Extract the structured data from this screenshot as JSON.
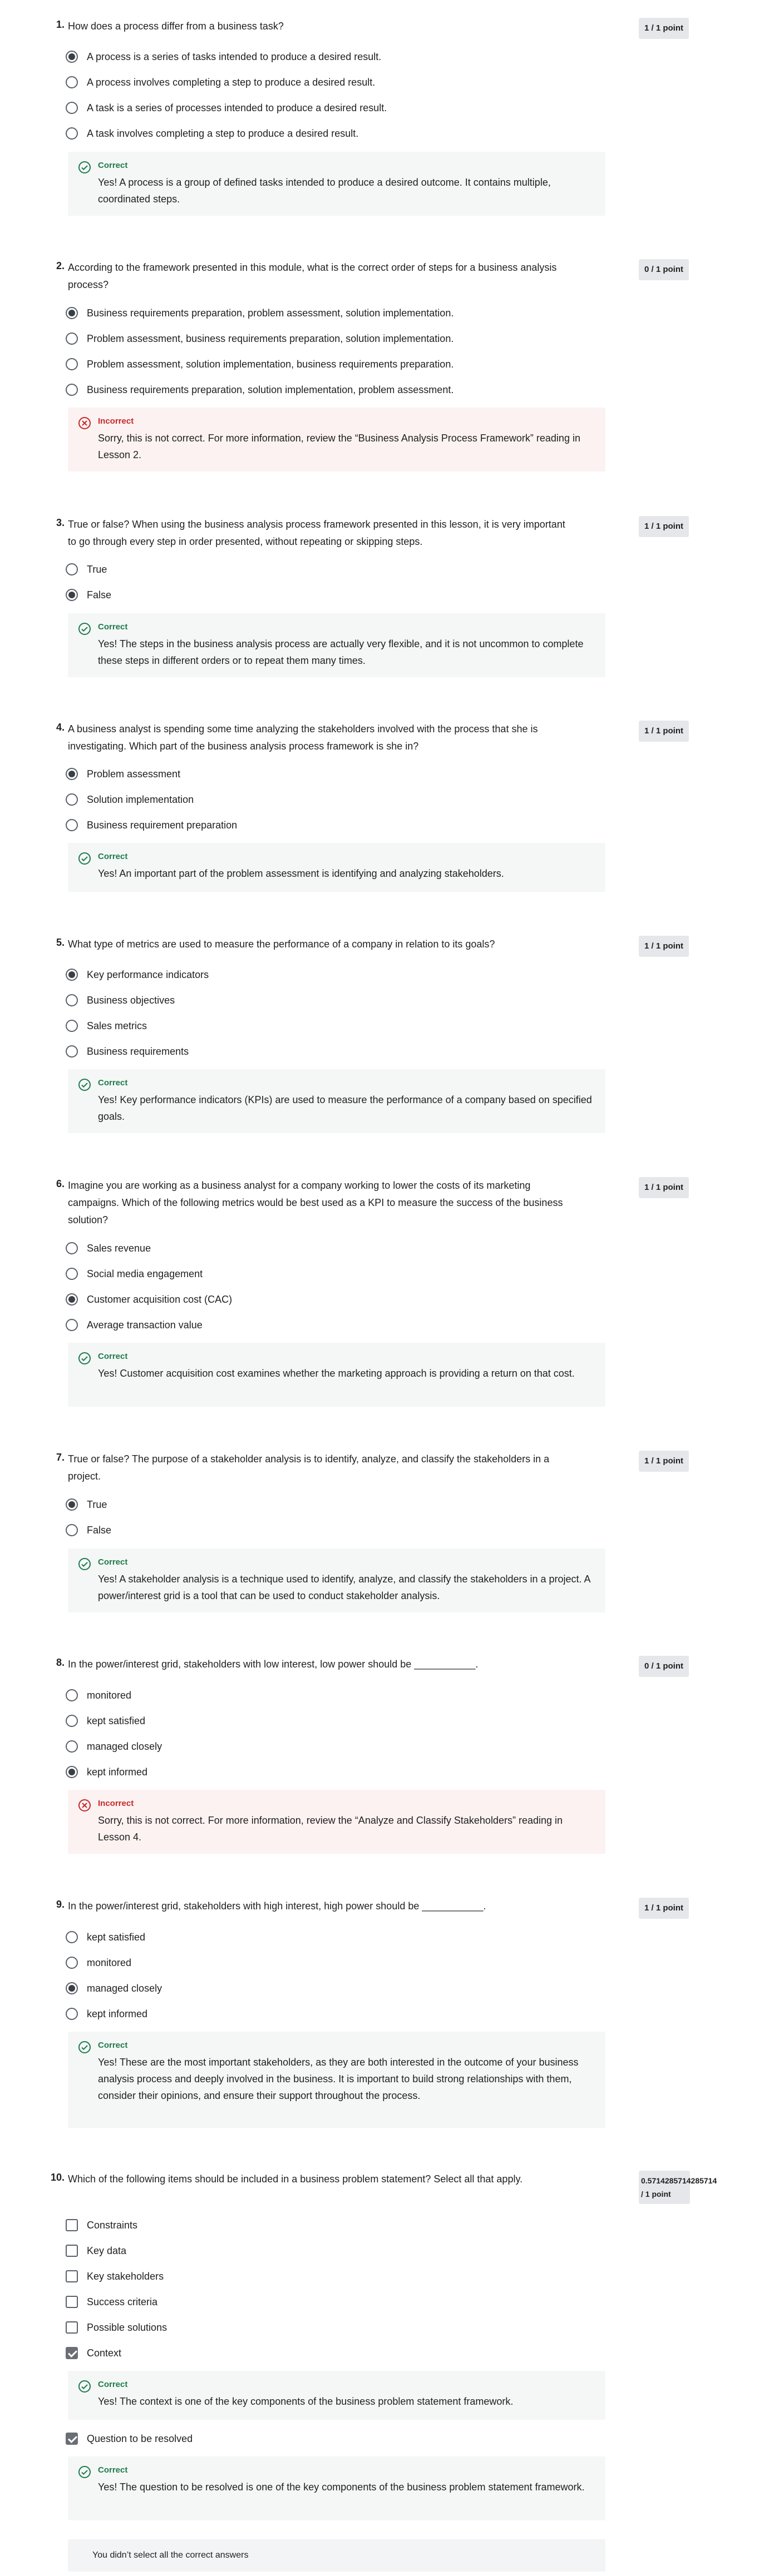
{
  "colors": {
    "correct": "#1f7a4d",
    "incorrect": "#c72727",
    "badge_bg": "#e5e7ea",
    "correct_bg": "#f4f7f6",
    "incorrect_bg": "#fcf2f2"
  },
  "questions": [
    {
      "number": "1.",
      "text": "How does a process differ from a business task?",
      "score": "1 / 1 point",
      "options": [
        "A process is a series of tasks intended to produce a desired result.",
        "A process involves completing a step to produce a desired result.",
        "A task is a series of processes intended to produce a desired result.",
        "A task involves completing a step to produce a desired result."
      ],
      "selected": [
        0
      ],
      "feedback": {
        "status": "Correct",
        "icon": "check-circle-icon",
        "text": "Yes! A process is a group of defined tasks intended to produce a desired outcome. It contains multiple, coordinated steps."
      }
    },
    {
      "number": "2.",
      "text": "According to the framework presented in this module, what is the correct order of steps for a business analysis process?",
      "score": "0 / 1 point",
      "options": [
        "Business requirements preparation, problem assessment, solution implementation.",
        "Problem assessment, business requirements preparation, solution implementation.",
        "Problem assessment, solution implementation, business requirements preparation.",
        "Business requirements preparation, solution implementation, problem assessment."
      ],
      "selected": [
        0
      ],
      "feedback": {
        "status": "Incorrect",
        "icon": "x-circle-icon",
        "text": "Sorry, this is not correct. For more information, review the “Business Analysis Process Framework” reading in Lesson 2."
      }
    },
    {
      "number": "3.",
      "text": "True or false? When using the business analysis process framework presented in this lesson, it is very important to go through every step in order presented, without repeating or skipping steps.",
      "score": "1 / 1 point",
      "options": [
        "True",
        "False"
      ],
      "selected": [
        1
      ],
      "feedback": {
        "status": "Correct",
        "icon": "check-circle-icon",
        "text": "Yes! The steps in the business analysis process are actually very flexible, and it is not uncommon to complete these steps in different orders or to repeat them many times."
      }
    },
    {
      "number": "4.",
      "text": "A business analyst is spending some time analyzing the stakeholders involved with the process that she is investigating. Which part of the business analysis process framework is she in?",
      "score": "1 / 1 point",
      "options": [
        "Problem assessment",
        "Solution implementation",
        "Business requirement preparation"
      ],
      "selected": [
        0
      ],
      "feedback": {
        "status": "Correct",
        "icon": "check-circle-icon",
        "text": "Yes! An important part of the problem assessment is identifying and analyzing stakeholders."
      }
    },
    {
      "number": "5.",
      "text": "What type of metrics are used to measure the performance of a company in relation to its goals?",
      "score": "1 / 1 point",
      "options": [
        "Key performance indicators",
        "Business objectives",
        "Sales metrics",
        "Business requirements"
      ],
      "selected": [
        0
      ],
      "feedback": {
        "status": "Correct",
        "icon": "check-circle-icon",
        "text": "Yes! Key performance indicators (KPIs) are used to measure the performance of a company based on specified goals."
      }
    },
    {
      "number": "6.",
      "text": "Imagine you are working as a business analyst for a company working to lower the costs of its marketing campaigns. Which of the following metrics would be best used as a KPI to measure the success of the business solution?",
      "score": "1 / 1 point",
      "options": [
        "Sales revenue",
        "Social media engagement",
        "Customer acquisition cost (CAC)",
        "Average transaction value"
      ],
      "selected": [
        2
      ],
      "feedback": {
        "status": "Correct",
        "icon": "check-circle-icon",
        "text": "Yes! Customer acquisition cost examines whether the marketing approach is providing a return on that cost."
      }
    },
    {
      "number": "7.",
      "text": "True or false? The purpose of a stakeholder analysis is to identify, analyze, and classify the stakeholders in a project.",
      "score": "1 / 1 point",
      "options": [
        "True",
        "False"
      ],
      "selected": [
        0
      ],
      "feedback": {
        "status": "Correct",
        "icon": "check-circle-icon",
        "text": "Yes! A stakeholder analysis is a technique used to identify, analyze, and classify the stakeholders in a project. A power/interest grid is a tool that can be used to conduct stakeholder analysis."
      }
    },
    {
      "number": "8.",
      "text": "In the power/interest grid, stakeholders with low interest, low power should be ___________.",
      "score": "0 / 1 point",
      "options": [
        "monitored",
        "kept satisfied",
        "managed closely",
        "kept informed"
      ],
      "selected": [
        3
      ],
      "feedback": {
        "status": "Incorrect",
        "icon": "x-circle-icon",
        "text": "Sorry, this is not correct. For more information, review the “Analyze and Classify Stakeholders” reading in Lesson 4."
      }
    },
    {
      "number": "9.",
      "text": "In the power/interest grid, stakeholders with high interest, high power should be ___________.",
      "score": "1 / 1 point",
      "options": [
        "kept satisfied",
        "monitored",
        "managed closely",
        "kept informed"
      ],
      "selected": [
        2
      ],
      "feedback": {
        "status": "Correct",
        "icon": "check-circle-icon",
        "text": "Yes! These are the most important stakeholders, as they are both interested in the outcome of your business analysis process and deeply involved in the business. It is important to build strong relationships with them, consider their opinions, and ensure their support throughout the process."
      }
    },
    {
      "number": "10.",
      "text": "Which of the following items should be included in a business problem statement? Select all that apply.",
      "score_line1": "0.5714285714285714",
      "score_line2": "/ 1 point",
      "options": [
        "Constraints",
        "Key data",
        "Key stakeholders",
        "Success criteria",
        "Possible solutions",
        "Context",
        "Question to be resolved"
      ],
      "selected": [
        5,
        6
      ],
      "feedback_context": {
        "status": "Correct",
        "icon": "check-circle-icon",
        "text": "Yes! The context is one of the key components of the business problem statement framework."
      },
      "feedback_question": {
        "status": "Correct",
        "icon": "check-circle-icon",
        "text": "Yes! The question to be resolved is one of the key components of the business problem statement framework."
      },
      "summary": "You didn’t select all the correct answers"
    }
  ]
}
